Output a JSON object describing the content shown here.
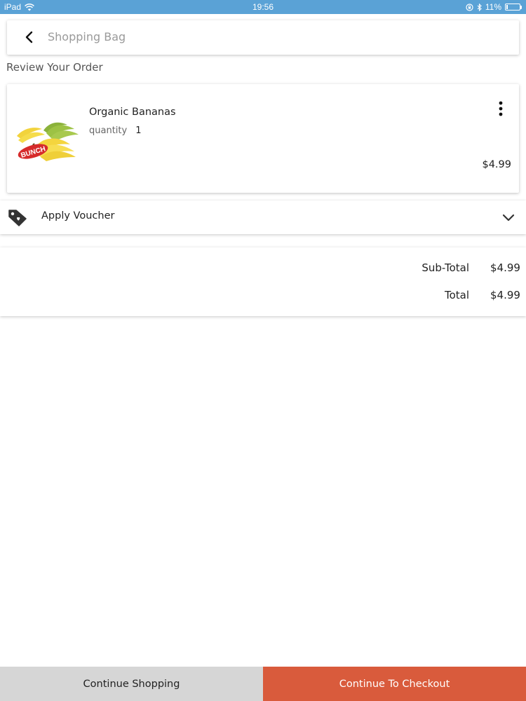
{
  "status_bar": {
    "device": "iPad",
    "time": "19:56",
    "battery_text": "11%",
    "battery_level": 0.11,
    "icons": [
      "wifi-icon",
      "lock-rotation-icon",
      "bluetooth-icon",
      "battery-icon"
    ]
  },
  "header": {
    "title": "Shopping Bag",
    "back_icon": "chevron-left-icon"
  },
  "section_label": "Review Your Order",
  "cart": {
    "items": [
      {
        "name": "Organic Bananas",
        "quantity_label": "quantity",
        "quantity": "1",
        "price": "$4.99",
        "image_label": "BUNCH",
        "menu_icon": "more-vertical-icon"
      }
    ]
  },
  "voucher": {
    "label": "Apply Voucher",
    "icon": "tag-icon",
    "toggle_icon": "chevron-down-icon"
  },
  "totals": {
    "subtotal_label": "Sub-Total",
    "subtotal_value": "$4.99",
    "total_label": "Total",
    "total_value": "$4.99"
  },
  "actions": {
    "continue_label": "Continue Shopping",
    "checkout_label": "Continue To Checkout"
  },
  "colors": {
    "status_bar": "#5aa2d6",
    "checkout": "#d95b3c",
    "continue": "#d6d6d6"
  }
}
